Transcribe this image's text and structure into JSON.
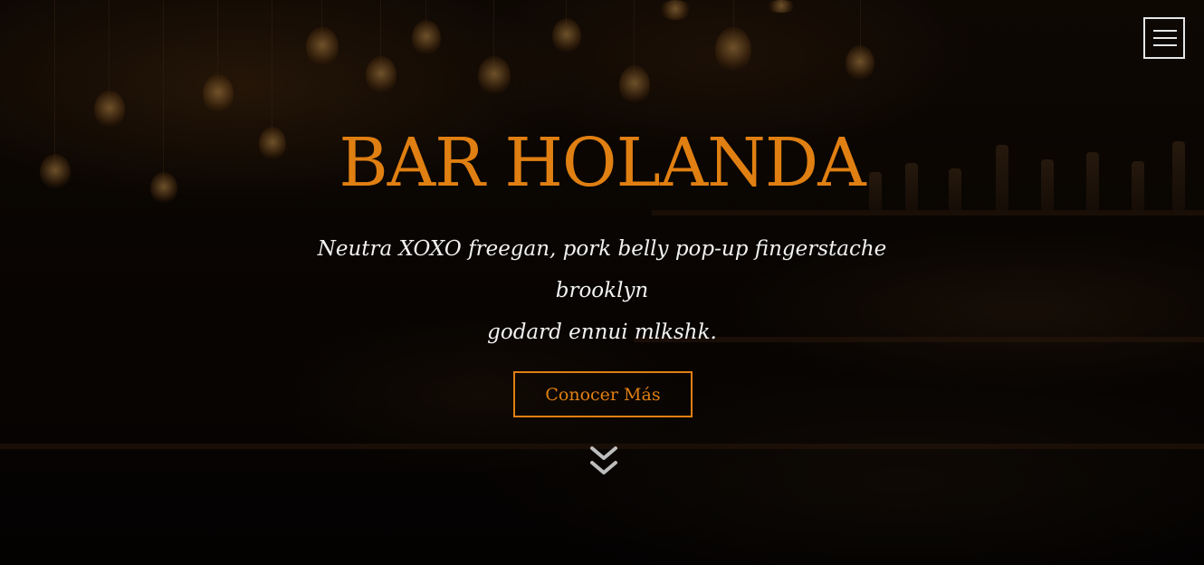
{
  "hero": {
    "title": "BAR HOLANDA",
    "subtitle_line1": "Neutra XOXO freegan, pork belly pop-up fingerstache brooklyn",
    "subtitle_line2": "godard ennui mlkshk.",
    "cta_label": "Conocer Más"
  },
  "icons": {
    "menu": "hamburger-menu-icon",
    "scroll": "double-chevron-down-icon"
  },
  "colors": {
    "accent": "#e07f12",
    "text": "#f2f2f2",
    "menu_border": "#e6e6e6",
    "overlay": "rgba(0,0,0,0.45)"
  }
}
